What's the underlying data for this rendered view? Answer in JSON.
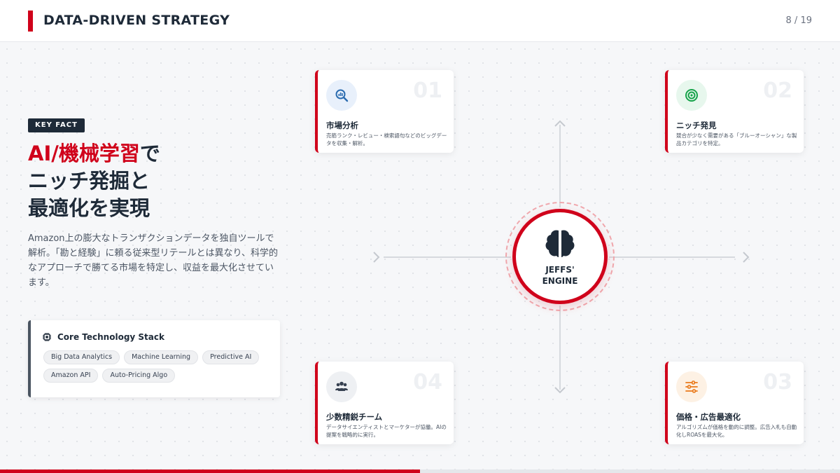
{
  "header": {
    "title": "DATA-DRIVEN STRATEGY",
    "page": "8 / 19"
  },
  "left": {
    "badge": "KEY FACT",
    "headline": {
      "accent": "AI/機械学習",
      "line1_rest": "で",
      "line2": "ニッチ発掘と",
      "line3": "最適化を実現"
    },
    "body": "Amazon上の膨大なトランザクションデータを独自ツールで解析。「勘と経験」に頼る従来型リテールとは異なり、科学的なアプローチで勝てる市場を特定し、収益を最大化させています。"
  },
  "stack": {
    "title": "Core Technology Stack",
    "icon": "chip-icon",
    "chips": [
      "Big Data Analytics",
      "Machine Learning",
      "Predictive AI",
      "Amazon API",
      "Auto-Pricing Algo"
    ]
  },
  "hub": {
    "icon": "brain-icon",
    "label": "JEFFS'\nENGINE"
  },
  "cards": [
    {
      "num": "01",
      "title": "市場分析",
      "desc": "売筋ランク・レビュー・検索語句などのビッグデータを収集・解析。",
      "icon": "chart-search-icon",
      "icon_color": "#2b6cb0",
      "icon_bg": "#e8f0fb"
    },
    {
      "num": "02",
      "title": "ニッチ発見",
      "desc": "競合が少なく需要がある「ブルーオーシャン」な製品カテゴリを特定。",
      "icon": "target-icon",
      "icon_color": "#16a34a",
      "icon_bg": "#e7f7ed"
    },
    {
      "num": "04",
      "title": "少数精鋭チーム",
      "desc": "データサイエンティストとマーケターが協働。AIの提案を戦略的に実行。",
      "icon": "team-icon",
      "icon_color": "#374151",
      "icon_bg": "#eef0f3"
    },
    {
      "num": "03",
      "title": "価格・広告最適化",
      "desc": "アルゴリズムが価格を動的に調整。広告入札も自動化しROASを最大化。",
      "icon": "sliders-icon",
      "icon_color": "#ea7a1a",
      "icon_bg": "#fdf1e4"
    }
  ],
  "progress": 0.5,
  "colors": {
    "accent": "#d0021b",
    "navy": "#1e2a38"
  }
}
